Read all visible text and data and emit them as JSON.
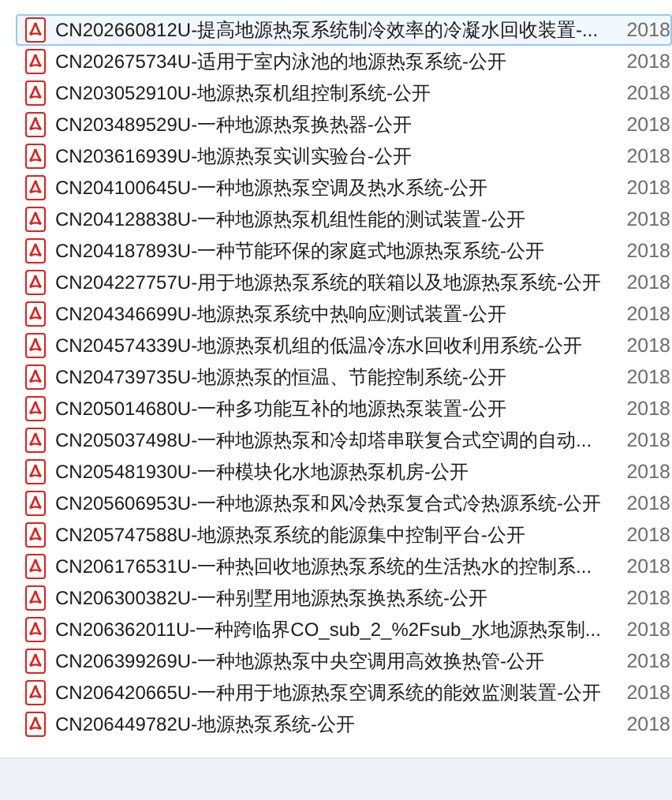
{
  "files": [
    {
      "name": "CN202660812U-提高地源热泵系统制冷效率的冷凝水回收装置-...",
      "date": "2018",
      "selected": true
    },
    {
      "name": "CN202675734U-适用于室内泳池的地源热泵系统-公开",
      "date": "2018",
      "selected": false
    },
    {
      "name": "CN203052910U-地源热泵机组控制系统-公开",
      "date": "2018",
      "selected": false
    },
    {
      "name": "CN203489529U-一种地源热泵换热器-公开",
      "date": "2018",
      "selected": false
    },
    {
      "name": "CN203616939U-地源热泵实训实验台-公开",
      "date": "2018",
      "selected": false
    },
    {
      "name": "CN204100645U-一种地源热泵空调及热水系统-公开",
      "date": "2018",
      "selected": false
    },
    {
      "name": "CN204128838U-一种地源热泵机组性能的测试装置-公开",
      "date": "2018",
      "selected": false
    },
    {
      "name": "CN204187893U-一种节能环保的家庭式地源热泵系统-公开",
      "date": "2018",
      "selected": false
    },
    {
      "name": "CN204227757U-用于地源热泵系统的联箱以及地源热泵系统-公开",
      "date": "2018",
      "selected": false
    },
    {
      "name": "CN204346699U-地源热泵系统中热响应测试装置-公开",
      "date": "2018",
      "selected": false
    },
    {
      "name": "CN204574339U-地源热泵机组的低温冷冻水回收利用系统-公开",
      "date": "2018",
      "selected": false
    },
    {
      "name": "CN204739735U-地源热泵的恒温、节能控制系统-公开",
      "date": "2018",
      "selected": false
    },
    {
      "name": "CN205014680U-一种多功能互补的地源热泵装置-公开",
      "date": "2018",
      "selected": false
    },
    {
      "name": "CN205037498U-一种地源热泵和冷却塔串联复合式空调的自动...",
      "date": "2018",
      "selected": false
    },
    {
      "name": "CN205481930U-一种模块化水地源热泵机房-公开",
      "date": "2018",
      "selected": false
    },
    {
      "name": "CN205606953U-一种地源热泵和风冷热泵复合式冷热源系统-公开",
      "date": "2018",
      "selected": false
    },
    {
      "name": "CN205747588U-地源热泵系统的能源集中控制平台-公开",
      "date": "2018",
      "selected": false
    },
    {
      "name": "CN206176531U-一种热回收地源热泵系统的生活热水的控制系...",
      "date": "2018",
      "selected": false
    },
    {
      "name": "CN206300382U-一种别墅用地源热泵换热系统-公开",
      "date": "2018",
      "selected": false
    },
    {
      "name": "CN206362011U-一种跨临界CO_sub_2_%2Fsub_水地源热泵制...",
      "date": "2018",
      "selected": false
    },
    {
      "name": "CN206399269U-一种地源热泵中央空调用高效换热管-公开",
      "date": "2018",
      "selected": false
    },
    {
      "name": "CN206420665U-一种用于地源热泵空调系统的能效监测装置-公开",
      "date": "2018",
      "selected": false
    },
    {
      "name": "CN206449782U-地源热泵系统-公开",
      "date": "2018",
      "selected": false
    }
  ]
}
